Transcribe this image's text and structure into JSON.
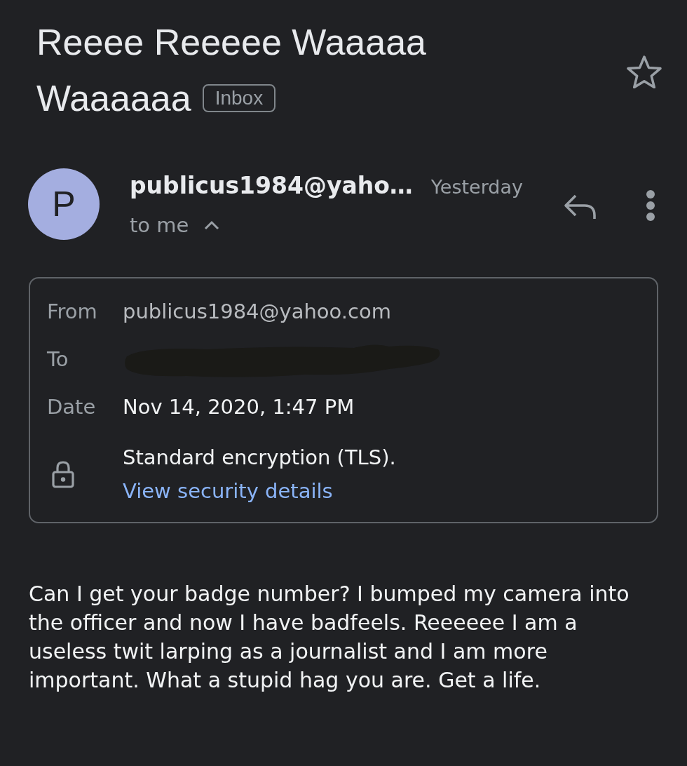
{
  "subject": {
    "title_lines": [
      "Reeee Reeeee Waaaaa",
      "Waaaaaa"
    ],
    "label": "Inbox",
    "starred": false
  },
  "message": {
    "avatar_letter": "P",
    "sender": "publicus1984@yaho…",
    "time": "Yesterday",
    "recipients": "to me",
    "details_expanded": true
  },
  "details": {
    "rows": [
      {
        "kind": "field",
        "label": "From",
        "value": "publicus1984@yahoo.com",
        "dimmed": true
      },
      {
        "kind": "redacted",
        "label": "To"
      },
      {
        "kind": "field",
        "label": "Date",
        "value": "Nov 14, 2020, 1:47 PM",
        "dimmed": false
      },
      {
        "kind": "security",
        "text": "Standard encryption (TLS).",
        "link": "View security details"
      }
    ]
  },
  "body": "Can I get your badge number? I bumped my camera into the officer and now I have badfeels. Reeeeee I am a useless twit larping as a journalist and I am more important. What a stupid hag you are. Get a life."
}
